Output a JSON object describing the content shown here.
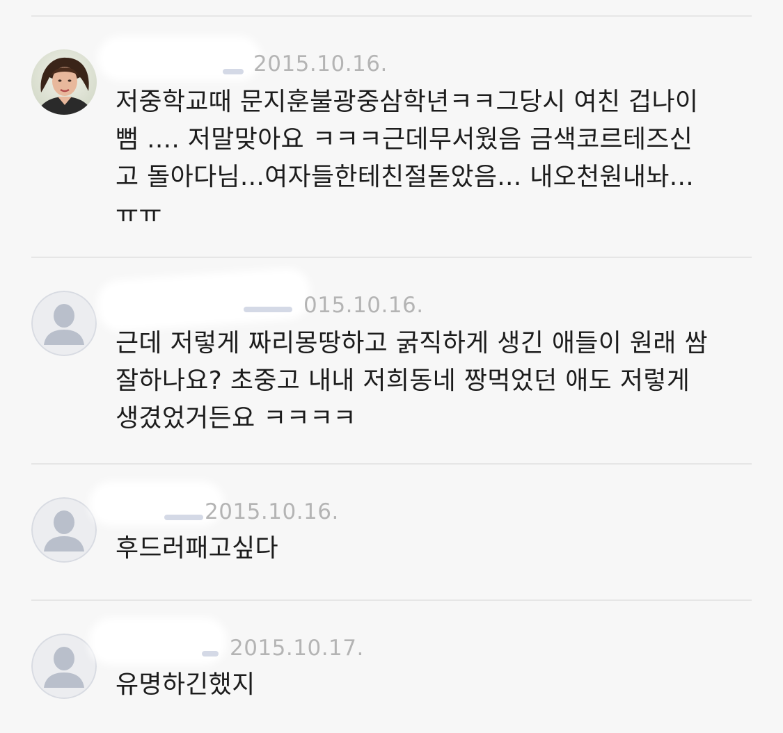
{
  "comments": [
    {
      "author_name": "",
      "date": "2015.10.16.",
      "avatar": "photo-avatar",
      "lines": [
        "저중학교때 문지훈불광중삼학년ㅋㅋ그당시 여친 겁나이",
        "뻠 .... 저말맞아요 ㅋㅋㅋ근데무서웠음 금색코르테즈신",
        "고 돌아다님...여자들한테친절돋았음... 내오천원내놔...",
        "ㅠㅠ"
      ]
    },
    {
      "author_name": "",
      "date": "015.10.16.",
      "avatar": "default-user-icon",
      "lines": [
        "근데 저렇게 짜리몽땅하고 굵직하게 생긴 애들이 원래 쌈",
        "잘하나요? 초중고 내내 저희동네 짱먹었던 애도 저렇게",
        "생겼었거든요 ㅋㅋㅋㅋ"
      ]
    },
    {
      "author_name": "",
      "date": "2015.10.16.",
      "avatar": "default-user-icon",
      "lines": [
        "후드러패고싶다"
      ]
    },
    {
      "author_name": "",
      "date": "2015.10.17.",
      "avatar": "default-user-icon",
      "lines": [
        "유명하긴했지"
      ]
    }
  ]
}
